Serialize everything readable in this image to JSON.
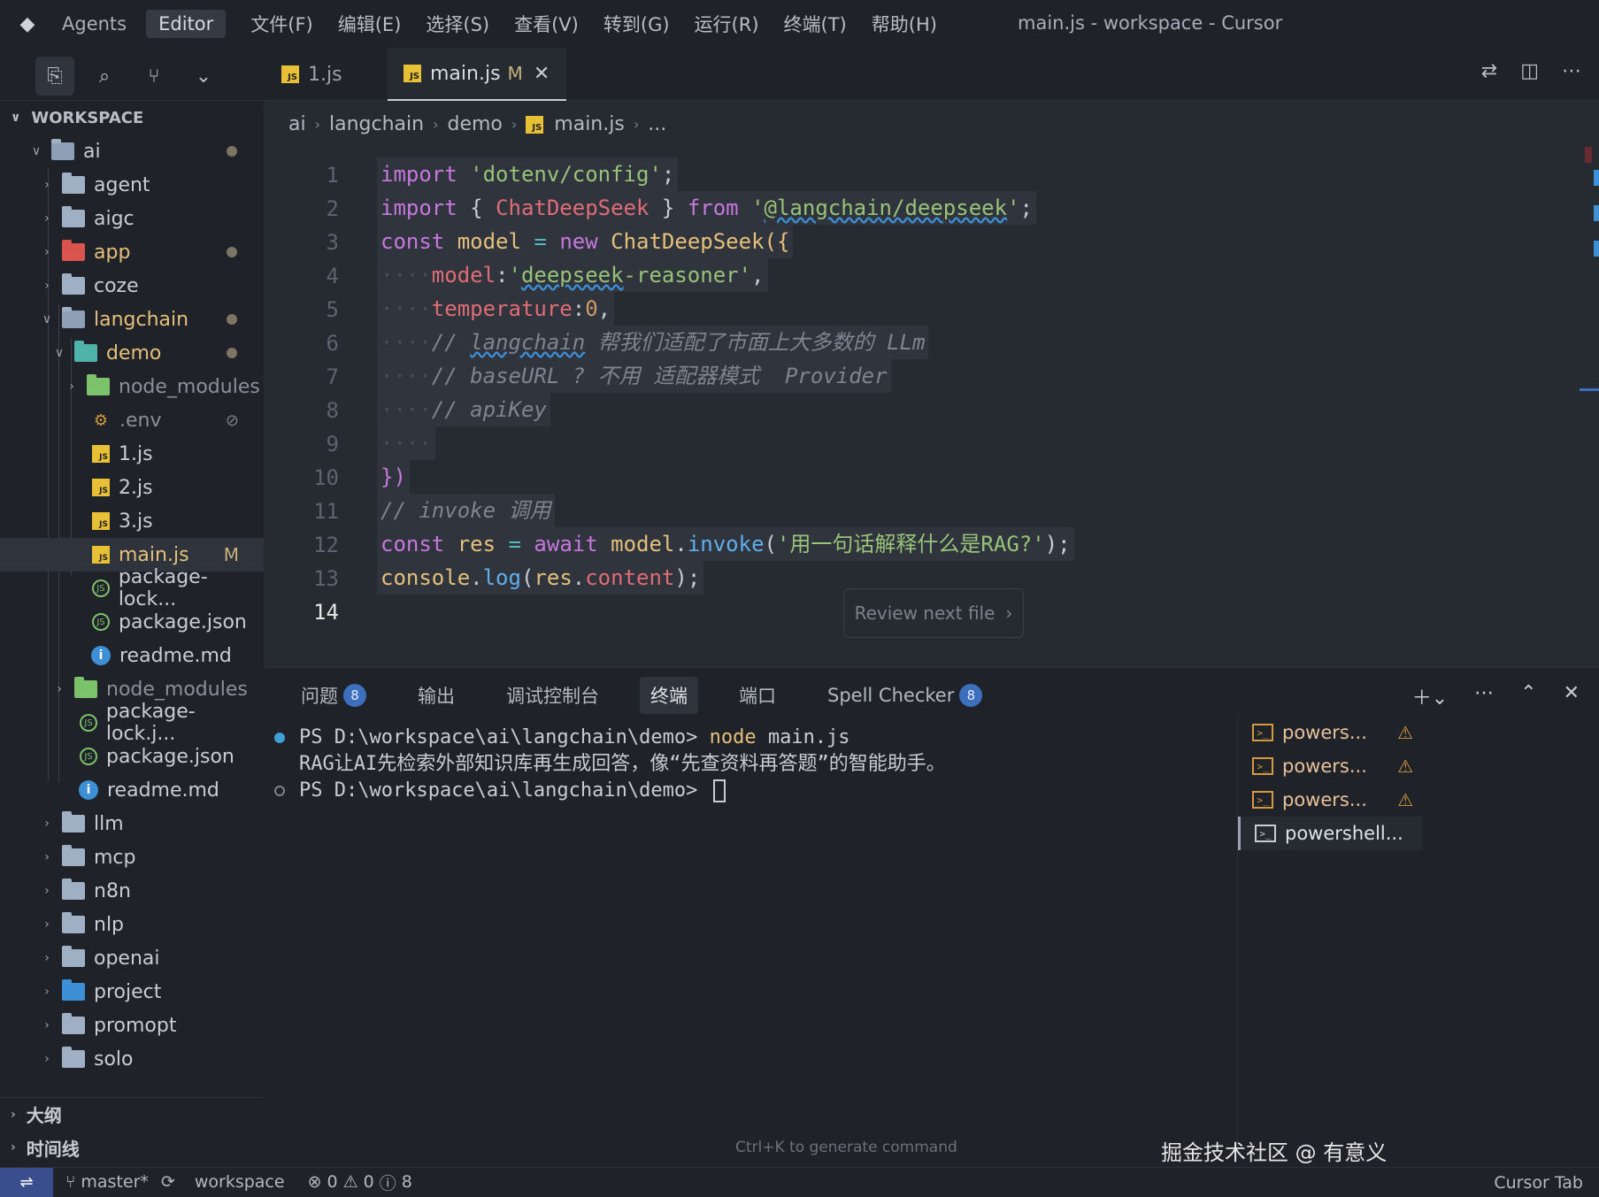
{
  "titlebar": {
    "agents": "Agents",
    "editor": "Editor",
    "menus": [
      "文件(F)",
      "编辑(E)",
      "选择(S)",
      "查看(V)",
      "转到(G)",
      "运行(R)",
      "终端(T)",
      "帮助(H)"
    ],
    "window_title": "main.js - workspace - Cursor"
  },
  "tabs": [
    {
      "name": "1.js",
      "modified": "",
      "active": false
    },
    {
      "name": "main.js",
      "modified": "M",
      "active": true
    }
  ],
  "explorer": {
    "header": "WORKSPACE",
    "items": [
      {
        "label": "ai",
        "dot": true
      },
      {
        "label": "agent"
      },
      {
        "label": "aigc"
      },
      {
        "label": "app",
        "dot": true
      },
      {
        "label": "coze"
      },
      {
        "label": "langchain",
        "dot": true
      },
      {
        "label": "demo",
        "dot": true
      },
      {
        "label": "node_modules"
      },
      {
        "label": ".env",
        "icon_right": "⊘"
      },
      {
        "label": "1.js"
      },
      {
        "label": "2.js"
      },
      {
        "label": "3.js"
      },
      {
        "label": "main.js",
        "flag": "M"
      },
      {
        "label": "package-lock..."
      },
      {
        "label": "package.json"
      },
      {
        "label": "readme.md"
      },
      {
        "label": "node_modules"
      },
      {
        "label": "package-lock.j..."
      },
      {
        "label": "package.json"
      },
      {
        "label": "readme.md"
      },
      {
        "label": "llm"
      },
      {
        "label": "mcp"
      },
      {
        "label": "n8n"
      },
      {
        "label": "nlp"
      },
      {
        "label": "openai"
      },
      {
        "label": "project"
      },
      {
        "label": "promopt"
      },
      {
        "label": "solo"
      }
    ],
    "outline": "大纲",
    "timeline": "时间线"
  },
  "breadcrumb": [
    "ai",
    "langchain",
    "demo",
    "main.js",
    "..."
  ],
  "code_lines": [
    "1",
    "2",
    "3",
    "4",
    "5",
    "6",
    "7",
    "8",
    "9",
    "10",
    "11",
    "12",
    "13",
    "14"
  ],
  "review_button": "Review next file",
  "panel": {
    "tabs": [
      {
        "label": "问题",
        "badge": "8"
      },
      {
        "label": "输出"
      },
      {
        "label": "调试控制台"
      },
      {
        "label": "终端"
      },
      {
        "label": "端口"
      },
      {
        "label": "Spell Checker",
        "badge": "8"
      }
    ],
    "terminal": {
      "prompt": "PS D:\\workspace\\ai\\langchain\\demo>",
      "cmd_node": "node",
      "cmd_arg": "main.js",
      "output": "RAG让AI先检索外部知识库再生成回答，像“先查资料再答题”的智能助手。"
    },
    "terminal_list": [
      "powers...",
      "powers...",
      "powers...",
      "powershell..."
    ],
    "hint": "Ctrl+K to generate command"
  },
  "watermark": "掘金技术社区 @ 有意义",
  "statusbar": {
    "branch": "master*",
    "workspace": "workspace",
    "errors": "0",
    "warnings": "0",
    "info": "8",
    "right": "Cursor Tab"
  }
}
